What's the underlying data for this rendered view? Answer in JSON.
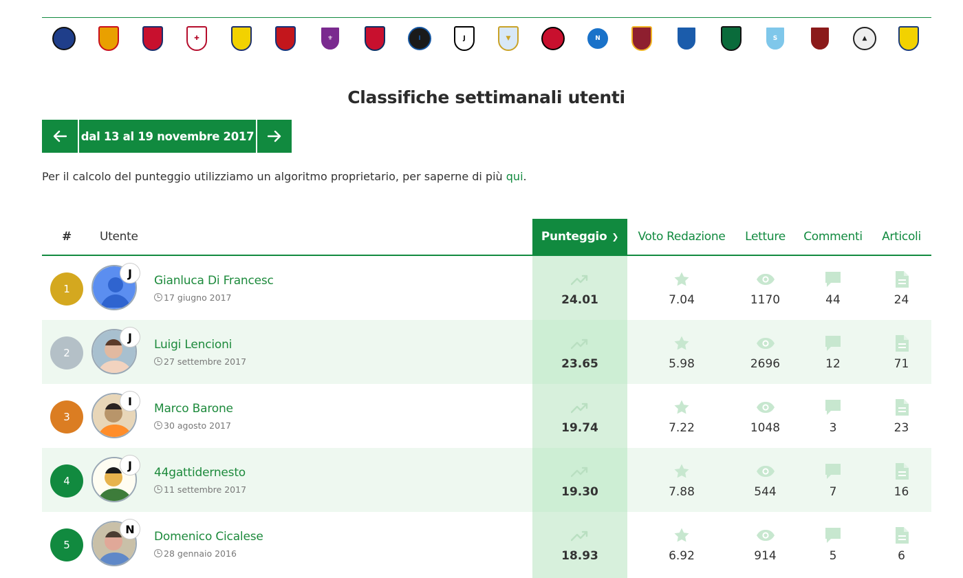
{
  "teams": [
    {
      "name": "atalanta-crest",
      "bg": "#1f3e8a",
      "fg": "#111",
      "shape": "round",
      "mark": ""
    },
    {
      "name": "benevento-crest",
      "bg": "#e9a000",
      "fg": "#c80f1c",
      "shape": "shield",
      "mark": ""
    },
    {
      "name": "bologna-crest",
      "bg": "#c8102e",
      "fg": "#1a2d6b",
      "shape": "shield",
      "mark": ""
    },
    {
      "name": "cagliari-crest",
      "bg": "#ffffff",
      "fg": "#b50d2c",
      "shape": "shield",
      "mark": "✚"
    },
    {
      "name": "chievo-crest",
      "bg": "#f2d200",
      "fg": "#1b2e6b",
      "shape": "shield",
      "mark": ""
    },
    {
      "name": "crotone-crest",
      "bg": "#c3161c",
      "fg": "#13317a",
      "shape": "shield",
      "mark": ""
    },
    {
      "name": "fiorentina-crest",
      "bg": "#7a2a8f",
      "fg": "#ffffff",
      "shape": "shield",
      "mark": "⚜"
    },
    {
      "name": "genoa-crest",
      "bg": "#c8102e",
      "fg": "#0c2e63",
      "shape": "shield",
      "mark": ""
    },
    {
      "name": "inter-crest",
      "bg": "#1a1a1a",
      "fg": "#1556a0",
      "shape": "round",
      "mark": "I"
    },
    {
      "name": "juventus-crest",
      "bg": "#ffffff",
      "fg": "#000000",
      "shape": "shield",
      "mark": "J"
    },
    {
      "name": "lazio-crest",
      "bg": "#d8e8f6",
      "fg": "#c9a227",
      "shape": "shield",
      "mark": "▼"
    },
    {
      "name": "milan-crest",
      "bg": "#c8102e",
      "fg": "#000000",
      "shape": "round",
      "mark": ""
    },
    {
      "name": "napoli-crest",
      "bg": "#1a72c9",
      "fg": "#ffffff",
      "shape": "round",
      "mark": "N"
    },
    {
      "name": "roma-crest",
      "bg": "#8e1f2f",
      "fg": "#f0b323",
      "shape": "shield",
      "mark": ""
    },
    {
      "name": "sampdoria-crest",
      "bg": "#1b5cab",
      "fg": "#ffffff",
      "shape": "shield",
      "mark": ""
    },
    {
      "name": "sassuolo-crest",
      "bg": "#0a6b3b",
      "fg": "#111111",
      "shape": "shield",
      "mark": ""
    },
    {
      "name": "spal-crest",
      "bg": "#7fc7ea",
      "fg": "#ffffff",
      "shape": "shield",
      "mark": "S"
    },
    {
      "name": "torino-crest",
      "bg": "#8b1a1a",
      "fg": "#ffffff",
      "shape": "shield",
      "mark": ""
    },
    {
      "name": "udinese-crest",
      "bg": "#eeeeee",
      "fg": "#222222",
      "shape": "round",
      "mark": "▲"
    },
    {
      "name": "verona-crest",
      "bg": "#f2d200",
      "fg": "#1b3b7a",
      "shape": "shield",
      "mark": ""
    }
  ],
  "page_title": "Classifiche settimanali utenti",
  "week_nav": {
    "range": "dal 13 al 19 novembre 2017",
    "prev_icon": "arrow-left-icon",
    "next_icon": "arrow-right-icon"
  },
  "info": {
    "text": "Per il calcolo del punteggio utilizziamo un algoritmo proprietario, per saperne di più ",
    "link": "qui",
    "after": "."
  },
  "headers": {
    "rank": "#",
    "user": "Utente",
    "score": "Punteggio",
    "voto": "Voto Redazione",
    "letture": "Letture",
    "commenti": "Commenti",
    "articoli": "Articoli"
  },
  "colors": {
    "green": "#118a3f",
    "gold": "#d4a81f",
    "silver": "#b4c0c7",
    "bronze": "#db7d22",
    "score_col": "#d7f0dc"
  },
  "rows": [
    {
      "rank": "1",
      "rank_color": "#d4a81f",
      "name": "Gianluca Di Francesc",
      "date": "17 giugno 2017",
      "badge": "J",
      "avatar": "default",
      "score": "24.01",
      "voto": "7.04",
      "letture": "1170",
      "commenti": "44",
      "articoli": "24"
    },
    {
      "rank": "2",
      "rank_color": "#b4c0c7",
      "name": "Luigi Lencioni",
      "date": "27 settembre 2017",
      "badge": "J",
      "avatar": "photo-a",
      "score": "23.65",
      "voto": "5.98",
      "letture": "2696",
      "commenti": "12",
      "articoli": "71"
    },
    {
      "rank": "3",
      "rank_color": "#db7d22",
      "name": "Marco Barone",
      "date": "30 agosto 2017",
      "badge": "I",
      "avatar": "photo-b",
      "score": "19.74",
      "voto": "7.22",
      "letture": "1048",
      "commenti": "3",
      "articoli": "23"
    },
    {
      "rank": "4",
      "rank_color": "#118a3f",
      "name": "44gattidernesto",
      "date": "11 settembre 2017",
      "badge": "J",
      "avatar": "photo-c",
      "score": "19.30",
      "voto": "7.88",
      "letture": "544",
      "commenti": "7",
      "articoli": "16"
    },
    {
      "rank": "5",
      "rank_color": "#118a3f",
      "name": "Domenico Cicalese",
      "date": "28 gennaio 2016",
      "badge": "N",
      "avatar": "photo-d",
      "score": "18.93",
      "voto": "6.92",
      "letture": "914",
      "commenti": "5",
      "articoli": "6"
    }
  ]
}
